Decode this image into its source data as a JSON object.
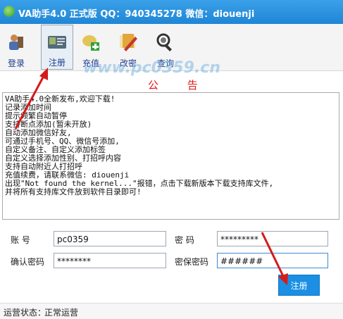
{
  "window": {
    "title": "VA助手4.0 正式版 QQ：940345278 微信：diouenji"
  },
  "watermark": "www.pc0359.cn",
  "toolbar": {
    "items": [
      {
        "label": "登录",
        "icon": "login-icon"
      },
      {
        "label": "注册",
        "icon": "register-icon",
        "active": true
      },
      {
        "label": "充值",
        "icon": "recharge-icon"
      },
      {
        "label": "改密",
        "icon": "change-password-icon"
      },
      {
        "label": "查询",
        "icon": "query-icon"
      }
    ]
  },
  "notice": {
    "title": "公 告",
    "lines": [
      "VA助手4.0全新发布,欢迎下载!",
      "记录添加时间",
      "提示频繁自动暂停",
      "支持断点添加(暂未开放)",
      "自动添加微信好友,",
      "可通过手机号、QQ、微信号添加,",
      "自定义备注、自定义添加标签",
      "自定义选择添加性别、打招呼内容",
      "支持自动附近人打招呼",
      "充值续费，请联系微信: diouenji",
      "出现\"Not found the kernel...\"报错，点击下载新版本下载支持库文件,",
      " 并将所有支持库文件放到软件目录即可!"
    ]
  },
  "form": {
    "account_label": "账    号",
    "account_value": "pc0359",
    "password_label": "密    码",
    "password_value": "*********",
    "confirm_label": "确认密码",
    "confirm_value": "********",
    "security_label": "密保密码",
    "security_value": "######",
    "register_button": "注册"
  },
  "status": {
    "label": "运营状态：",
    "value": "正常运营"
  },
  "colors": {
    "titlebar": "#1f86d6",
    "notice_title": "#e01818",
    "button": "#1a8fe4",
    "arrow": "#d61a1a"
  }
}
